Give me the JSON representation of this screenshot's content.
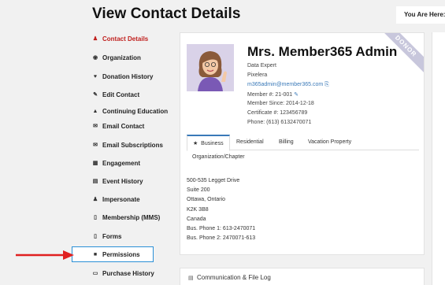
{
  "header": {
    "title": "View Contact Details",
    "breadcrumb_label": "You Are Here:"
  },
  "sidebar": {
    "items": [
      {
        "label": "Contact Details",
        "icon": "person-icon",
        "glyph": "♟",
        "active": true
      },
      {
        "label": "Organization",
        "icon": "eye-icon",
        "glyph": "◉"
      },
      {
        "label": "Donation History",
        "icon": "heart-icon",
        "glyph": "♥"
      },
      {
        "label": "Edit Contact",
        "icon": "edit-icon",
        "glyph": "✎"
      },
      {
        "label": "Continuing Education",
        "icon": "graduation-cap-icon",
        "glyph": "▲"
      },
      {
        "label": "Email Contact",
        "icon": "envelope-icon",
        "glyph": "✉"
      },
      {
        "label": "Email Subscriptions",
        "icon": "envelope-outline-icon",
        "glyph": "✉"
      },
      {
        "label": "Engagement",
        "icon": "grid-icon",
        "glyph": "▦"
      },
      {
        "label": "Event History",
        "icon": "calendar-icon",
        "glyph": "▤"
      },
      {
        "label": "Impersonate",
        "icon": "user-secret-icon",
        "glyph": "♟"
      },
      {
        "label": "Membership (MMS)",
        "icon": "bookmark-icon",
        "glyph": "▯"
      },
      {
        "label": "Forms",
        "icon": "form-icon",
        "glyph": "▯"
      },
      {
        "label": "Permissions",
        "icon": "lock-icon",
        "glyph": "■",
        "highlighted": true
      },
      {
        "label": "Purchase History",
        "icon": "receipt-icon",
        "glyph": "▭"
      }
    ]
  },
  "profile": {
    "name": "Mrs. Member365 Admin",
    "badge": "DONOR",
    "title": "Data Expert",
    "company": "Pixelera",
    "email": "m365admin@member365.com",
    "member_number": "Member #: 21-001",
    "member_since": "Member Since: 2014-12-18",
    "certificate": "Certificate #: 123456789",
    "phone": "Phone: (613) 6132470071"
  },
  "tabs": [
    {
      "label": "Business",
      "icon": "star-icon",
      "active": true
    },
    {
      "label": "Residential"
    },
    {
      "label": "Billing"
    },
    {
      "label": "Vacation Property"
    },
    {
      "label": "Organization/Chapter"
    }
  ],
  "address_lines": [
    "500-535 Legget Drive",
    "Suite 200",
    "Ottawa, Ontario",
    "K2K 3B8",
    "Canada",
    "Bus. Phone 1: 613-2470071",
    "Bus. Phone 2: 2470071-613"
  ],
  "panels": {
    "communication_label": "Communication & File Log"
  },
  "colors": {
    "accent_red": "#c0201e",
    "link_blue": "#3a79b8",
    "highlight_blue": "#2a8fd6",
    "arrow_red": "#e02020"
  }
}
